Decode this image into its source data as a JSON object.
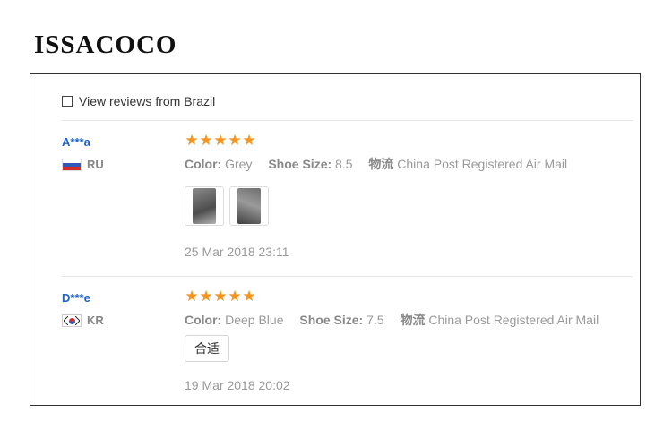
{
  "brand": {
    "name": "ISSACOCO"
  },
  "filter": {
    "label": "View reviews from Brazil",
    "checked": false
  },
  "reviews": [
    {
      "user": "A***a",
      "country": "RU",
      "flag_icon": "russia-flag-icon",
      "rating": 5,
      "color_label": "Color:",
      "color": "Grey",
      "size_label": "Shoe Size:",
      "size": "8.5",
      "shipping_label": "物流",
      "shipping": "China Post Registered Air Mail",
      "photos": [
        "review-photo-1",
        "review-photo-2"
      ],
      "date": "25 Mar 2018 23:11"
    },
    {
      "user": "D***e",
      "country": "KR",
      "flag_icon": "south-korea-flag-icon",
      "rating": 5,
      "color_label": "Color:",
      "color": "Deep Blue",
      "size_label": "Shoe Size:",
      "size": "7.5",
      "shipping_label": "物流",
      "shipping": "China Post Registered Air Mail",
      "tag": "合适",
      "date": "19 Mar 2018 20:02"
    }
  ],
  "colors": {
    "star": "#f7941d",
    "username": "#1f63c6",
    "meta": "#999999"
  }
}
